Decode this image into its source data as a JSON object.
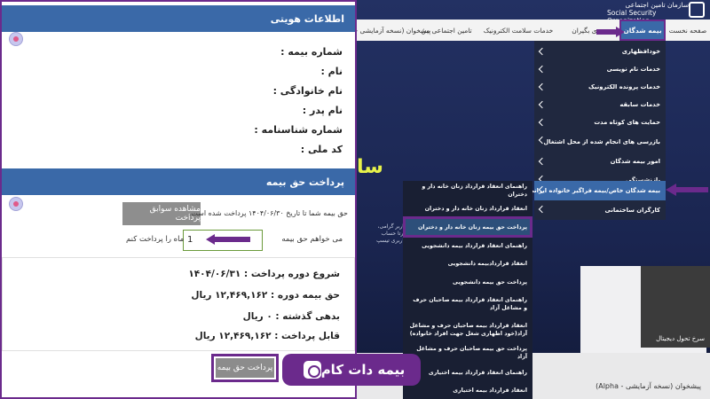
{
  "identity": {
    "title": "اطلاعات هویتی",
    "fields": [
      "شماره بیمه :",
      "نام :",
      "نام خانوادگی :",
      "نام پدر :",
      "شماره شناسنامه :",
      "کد ملی :"
    ]
  },
  "payment": {
    "title": "پرداخت حق بیمه",
    "history_button": "مشاهده سوابق پرداخت",
    "info_text": "حق بیمه شما تا تاریخ ۱۴۰۴/۰۶/۳۰ پرداخت شده است.",
    "want_label": "می خواهم حق بیمه",
    "month_value": "1",
    "month_label": "ماه را پرداخت کنم",
    "summary": [
      "شروع دوره پرداخت : ۱۴۰۴/۰۶/۳۱",
      "حق بیمه دوره : ۱۲,۴۶۹,۱۶۲ ریال",
      "بدهی گذشته : ۰ ریال",
      "قابل پرداخت : ۱۲,۴۶۹,۱۶۲ ریال"
    ],
    "pay_button": "پرداخت حق بیمه"
  },
  "header": {
    "logo_fa": "سازمان تامین اجتماعی",
    "logo_en": "Social Security Organization"
  },
  "nav": {
    "items": [
      "صفحه نخست",
      "بیمه شدگان",
      "...ی بگیران",
      "خدمات سلامت الکترونیک",
      "تامین اجتماعی من",
      "پیشخوان (نسخه آزمایشی - ..."
    ]
  },
  "menu": {
    "items": [
      "خودافظهاری",
      "خدمات نام نویسی",
      "خدمات پرونده الکترونیک",
      "خدمات سابقه",
      "حمایت های کوتاه مدت",
      "بازرسی های انجام شده از محل اشتغال",
      "امور بیمه شدگان",
      "بازنشستگی",
      "بیمه شدگان خاص/بیمه فراگیر خانواده ایرانی",
      "کارگران ساختمانی"
    ]
  },
  "submenu": {
    "items": [
      "راهنمای انعقاد قرارداد زنان خانه دار و دختران",
      "انعقاد قرارداد زنان خانه دار و دختران",
      "پرداخت حق بیمه زنان خانه دار و دختران",
      "راهنمای انعقاد قرارداد بیمه دانشجویی",
      "انعقاد قراردادبیمه دانشجویی",
      "پرداخت حق بیمه دانشجویی",
      "راهنمای انعقاد قرارداد بیمه صاحبان حرف و مشاغل آزاد",
      "انعقاد قرارداد بیمه صاحبان حرف و مشاغل آزاد(خود اظهاری شغل جهت افراد خانواده)",
      "پرداخت حق بیمه صاحبان حرف و مشاغل آزاد",
      "راهنمای انعقاد قرارداد بیمه اختیاری",
      "انعقاد قرارداد بیمه اختیاری"
    ]
  },
  "hero": {
    "text": "سا",
    "side_text": "کاربر گرامی، مرتا حساب کاربری تیسپ"
  },
  "cards": {
    "card3_text": "سرخ تحول دیجیتال"
  },
  "footer": {
    "alpha": "پیشخوان (نسخه آزمایشی - Alpha)"
  },
  "watermark": {
    "text": "بیمه دات کام"
  },
  "colors": {
    "primary": "#3a69a8",
    "accent": "#6b2a8c",
    "nav_bg": "#f3f3f3",
    "menu_bg": "#20283f"
  }
}
